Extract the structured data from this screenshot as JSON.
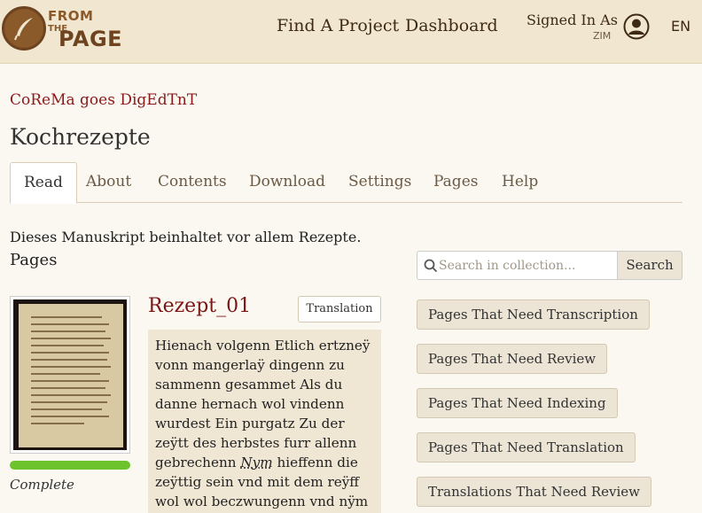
{
  "header": {
    "logo": {
      "from": "FROM",
      "the": "THE",
      "page": "PAGE"
    },
    "nav": {
      "find_project": "Find A Project",
      "dashboard": "Dashboard"
    },
    "signed_in_label": "Signed In As",
    "user": "ZIM",
    "language": "EN"
  },
  "collection_link": "CoReMa goes DigEdTnT",
  "work_title": "Kochrezepte",
  "tabs": [
    {
      "label": "Read",
      "active": true
    },
    {
      "label": "About"
    },
    {
      "label": "Contents"
    },
    {
      "label": "Download"
    },
    {
      "label": "Settings"
    },
    {
      "label": "Pages"
    },
    {
      "label": "Help"
    }
  ],
  "description": "Dieses Manuskript beinhaltet vor allem Rezepte.",
  "pages_heading": "Pages",
  "search": {
    "placeholder": "Search in collection...",
    "button": "Search"
  },
  "page_entry": {
    "title": "Rezept_01",
    "translation_button": "Translation",
    "progress_fraction": 1.0,
    "status": "Complete",
    "excerpt_before": "Hienach volgenn Etlich ertzneÿ vonn mangerlaÿ dingenn zu sammenn gesammet Als du danne hernach wol vindenn wurdest Ein purgatz Zu der zeÿtt des herbstes furr allenn gebrechenn ",
    "excerpt_link": "Nym",
    "excerpt_after": " hieffenn die zeÿttig sein vnd mit dem reÿff wol wol beczwungenn vnd nÿm die mit kernn vnd mit all"
  },
  "side_buttons": [
    "Pages That Need Transcription",
    "Pages That Need Review",
    "Pages That Need Indexing",
    "Pages That Need Translation",
    "Translations That Need Review"
  ],
  "colors": {
    "header_bg": "#f1e6cf",
    "accent_red": "#8b1a1a",
    "progress_green": "#6dc32b"
  }
}
